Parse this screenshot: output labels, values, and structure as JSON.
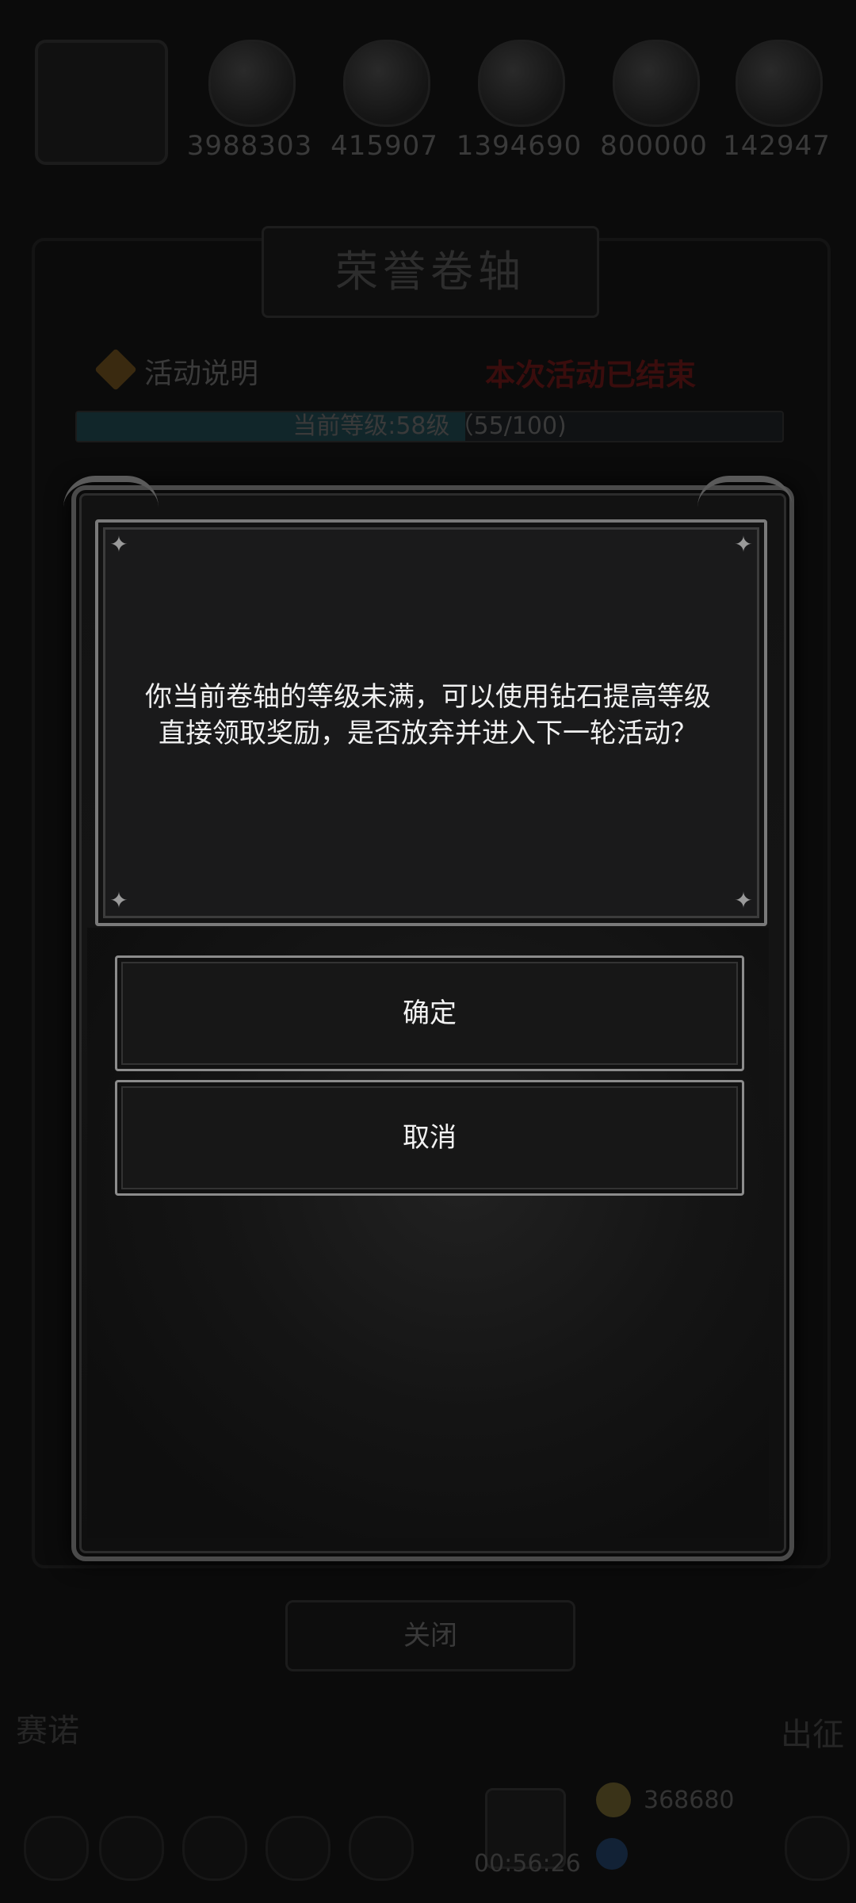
{
  "resources": {
    "values": [
      "3988303",
      "415907",
      "1394690",
      "800000",
      "142947"
    ]
  },
  "panel": {
    "title": "荣誉卷轴",
    "activity_label": "活动说明",
    "status_text": "本次活动已结束",
    "progress_text": "当前等级:58级（55/100)",
    "progress_fraction": 0.55,
    "close_label": "关闭"
  },
  "bottom": {
    "left_text": "赛诺",
    "right_text": "出征",
    "timer": "00:56:26",
    "coin_value": "368680"
  },
  "dialog": {
    "message": "你当前卷轴的等级未满，可以使用钻石提高等级直接领取奖励，是否放弃并进入下一轮活动？",
    "confirm_label": "确定",
    "cancel_label": "取消"
  }
}
